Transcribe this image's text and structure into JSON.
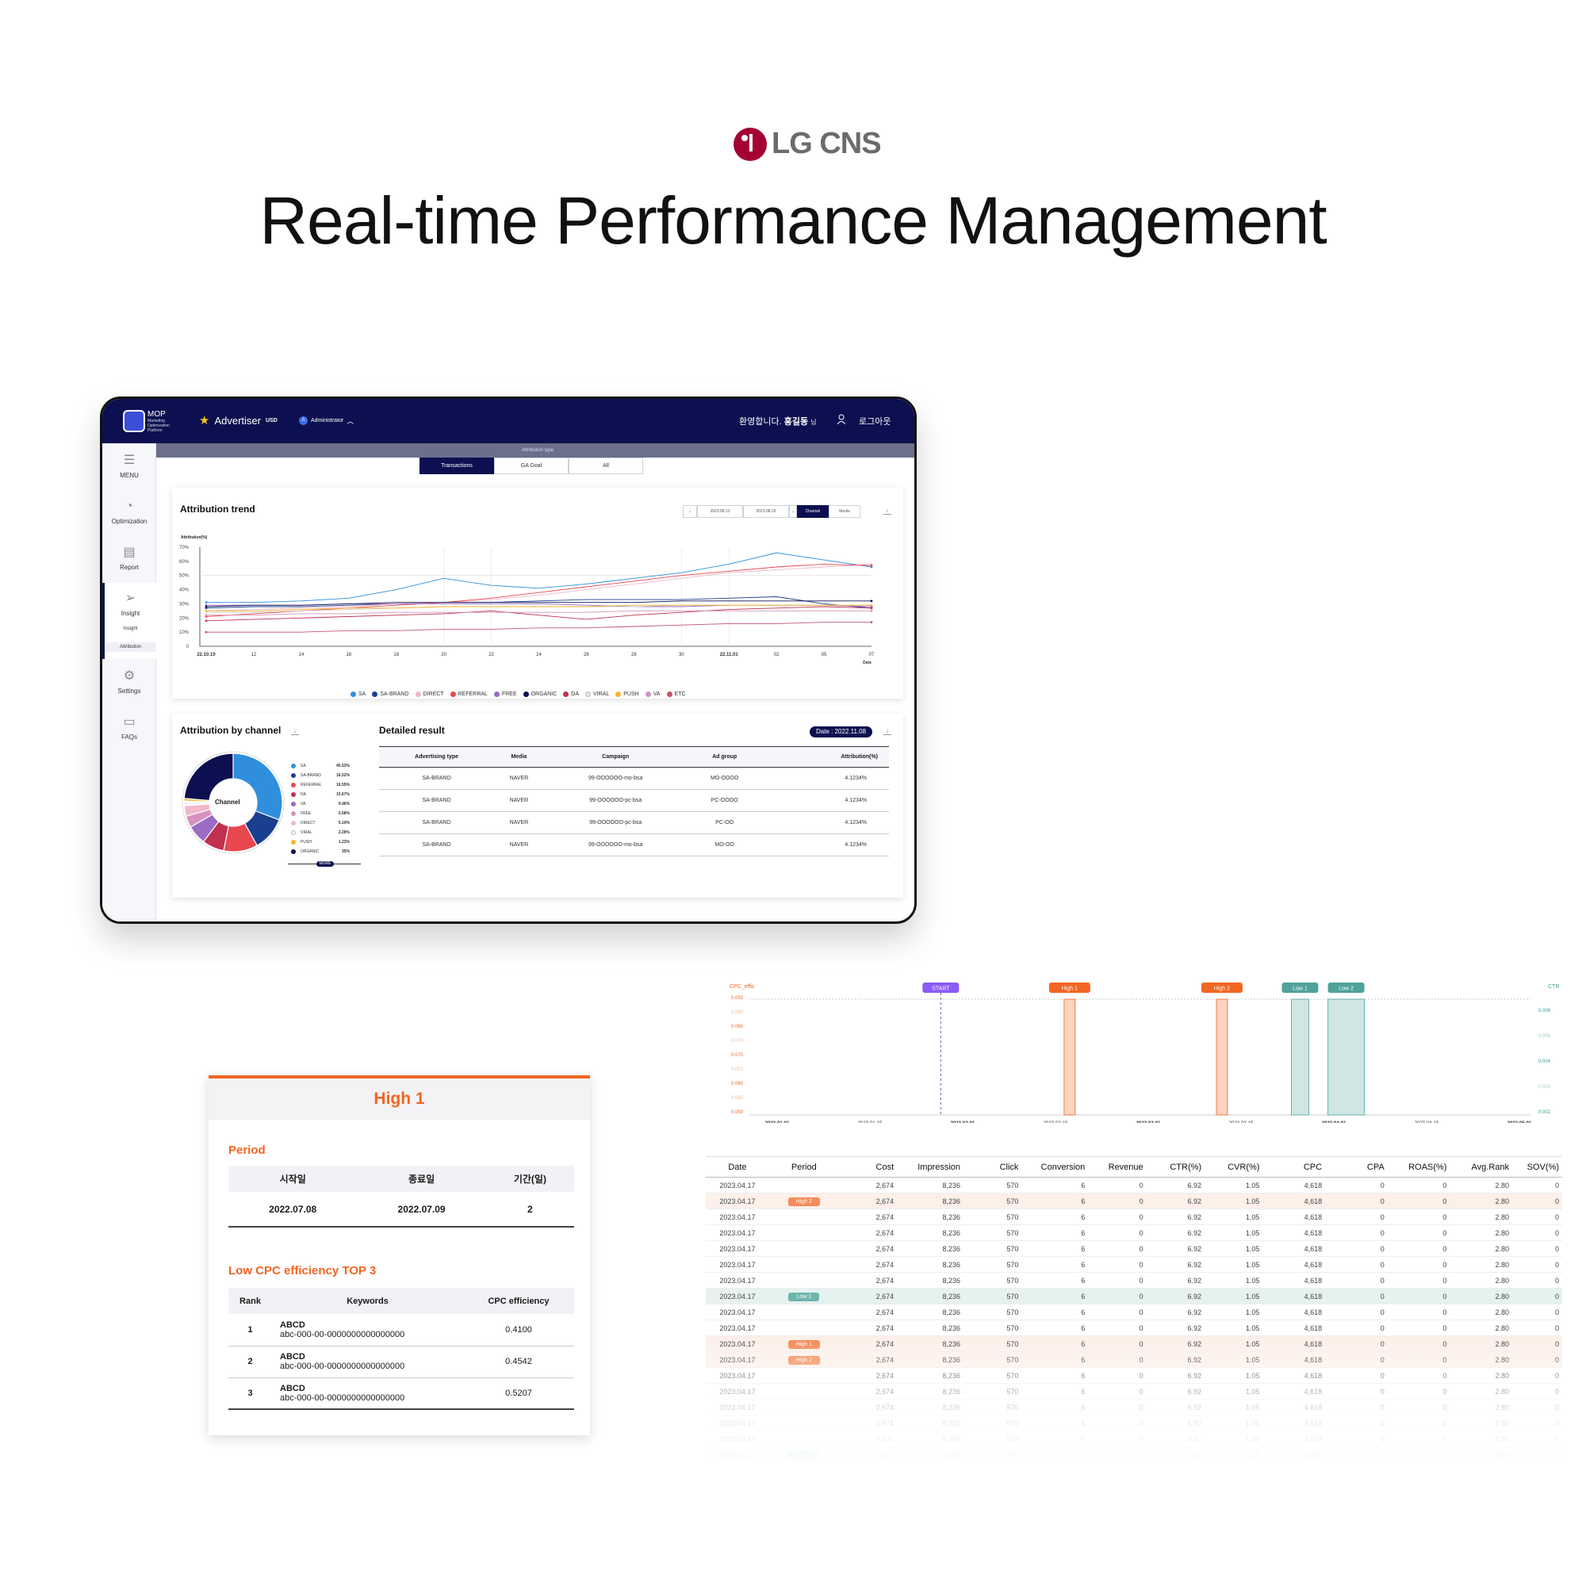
{
  "header": {
    "brand": "LG CNS",
    "title": "Real-time Performance Management"
  },
  "dashboard": {
    "topbar": {
      "logo": "MOP",
      "logo_sub": "Marketing Optimization Platform",
      "advertiser": "Advertiser",
      "currency": "USD",
      "role": "Administrator",
      "welcome_prefix": "환영합니다.",
      "user_name": "홍길동",
      "user_suffix": "님",
      "logout": "로그아웃"
    },
    "sidebar": [
      {
        "label": "MENU",
        "icon": "hamburger-icon"
      },
      {
        "label": "Optimization",
        "icon": "pie-icon"
      },
      {
        "label": "Report",
        "icon": "report-icon"
      },
      {
        "label": "Insight",
        "icon": "send-icon"
      },
      {
        "label": "Settings",
        "icon": "gear-icon"
      },
      {
        "label": "FAQs",
        "icon": "chat-icon"
      }
    ],
    "sidebar_sub": [
      "Insight",
      "Attribution"
    ],
    "attribution_type_label": "Attribution type",
    "tabs": [
      "Transactions",
      "GA Goal",
      "All"
    ],
    "trend": {
      "title": "Attribution trend",
      "date_from": "2023.08.12",
      "date_to": "2023.08.29",
      "toggle": [
        "Channel",
        "Media"
      ]
    },
    "by_channel": {
      "title": "Attribution by channel",
      "center": "Channel",
      "more": "MORE"
    },
    "detail": {
      "title": "Detailed result",
      "date_label": "Date : 2022.11.08",
      "headers": [
        "Advertising type",
        "Media",
        "Campaign",
        "Ad group",
        "Attribution(%)"
      ],
      "rows": [
        [
          "SA-BRAND",
          "NAVER",
          "99-OOOOOO-mo-bsa",
          "MO-OOOO",
          "4.1234%"
        ],
        [
          "SA-BRAND",
          "NAVER",
          "99-OOOOOO-pc-bsa",
          "PC-OOOO",
          "4.1234%"
        ],
        [
          "SA-BRAND",
          "NAVER",
          "99-OOOOOO-pc-bsa",
          "PC-OO",
          "4.1234%"
        ],
        [
          "SA-BRAND",
          "NAVER",
          "99-OOOOOO-mo-bsa",
          "MO-OO",
          "4.1234%"
        ]
      ]
    }
  },
  "chart_data": [
    {
      "type": "line",
      "title": "Attribution trend",
      "ylabel": "Attribution(%)",
      "xlabel": "Date",
      "ylim": [
        0,
        70
      ],
      "yticks": [
        "0",
        "10%",
        "20%",
        "30%",
        "40%",
        "50%",
        "60%",
        "70%"
      ],
      "x": [
        "22.10.10",
        "12",
        "14",
        "16",
        "18",
        "20",
        "22",
        "24",
        "26",
        "28",
        "30",
        "22.11.01",
        "02",
        "05",
        "07"
      ],
      "series": [
        {
          "name": "SA",
          "color": "#2f8fdc",
          "values": [
            31,
            31,
            32,
            34,
            40,
            48,
            43,
            41,
            44,
            48,
            52,
            58,
            66,
            61,
            56
          ]
        },
        {
          "name": "SA-BRAND",
          "color": "#1a3f8f",
          "values": [
            27,
            28,
            28,
            29,
            30,
            31,
            31,
            32,
            33,
            33,
            33,
            34,
            35,
            30,
            27
          ]
        },
        {
          "name": "DIRECT",
          "color": "#f0b8c8",
          "values": [
            25,
            26,
            27,
            28,
            30,
            31,
            33,
            36,
            40,
            44,
            48,
            52,
            54,
            56,
            58
          ]
        },
        {
          "name": "REFERRAL",
          "color": "#e8474e",
          "values": [
            21,
            23,
            25,
            27,
            29,
            31,
            34,
            38,
            42,
            46,
            50,
            53,
            56,
            58,
            57
          ]
        },
        {
          "name": "FREE",
          "color": "#9b6cc4",
          "values": [
            29,
            29,
            29,
            30,
            30,
            30,
            30,
            30,
            29,
            28,
            28,
            29,
            29,
            29,
            28
          ]
        },
        {
          "name": "ORGANIC",
          "color": "#0c1050",
          "values": [
            28,
            29,
            29,
            30,
            31,
            31,
            31,
            31,
            31,
            31,
            32,
            32,
            32,
            32,
            32
          ]
        },
        {
          "name": "DA",
          "color": "#c0304f",
          "values": [
            18,
            19,
            20,
            21,
            22,
            23,
            25,
            22,
            19,
            22,
            24,
            26,
            27,
            28,
            27
          ]
        },
        {
          "name": "VIRAL",
          "color": "#e6e6e6",
          "values": [
            24,
            24,
            25,
            26,
            27,
            28,
            28,
            28,
            28,
            28,
            29,
            29,
            29,
            29,
            29
          ]
        },
        {
          "name": "PUSH",
          "color": "#f4b32b",
          "values": [
            25,
            25,
            26,
            27,
            27,
            28,
            28,
            28,
            28,
            29,
            29,
            29,
            29,
            29,
            29
          ]
        },
        {
          "name": "VA",
          "color": "#d592be",
          "values": [
            22,
            22,
            23,
            23,
            24,
            24,
            24,
            24,
            24,
            25,
            25,
            25,
            25,
            25,
            25
          ]
        },
        {
          "name": "ETC",
          "color": "#c4566b",
          "values": [
            10,
            10,
            10,
            11,
            11,
            12,
            12,
            13,
            13,
            14,
            15,
            16,
            16,
            17,
            17
          ]
        }
      ]
    },
    {
      "type": "pie",
      "title": "Attribution by channel",
      "categories": [
        "SA",
        "SA-BRAND",
        "REFERRAL",
        "DA",
        "VA",
        "FREE",
        "DIRECT",
        "VIRAL",
        "PUSH",
        "ORGANIC"
      ],
      "values": [
        45.53,
        16.52,
        16.55,
        10.67,
        9.46,
        5.58,
        5.19,
        2.28,
        1.23,
        35
      ],
      "labels": [
        "45.53%",
        "16.52%",
        "16.55%",
        "10.67%",
        "9.46%",
        "5.58%",
        "5.19%",
        "2.28%",
        "1.23%",
        "35%"
      ],
      "colors": [
        "#2f8fdc",
        "#1a3f8f",
        "#e8474e",
        "#c0304f",
        "#9b6cc4",
        "#d592be",
        "#f0b8c8",
        "#f4f4f4",
        "#f4b32b",
        "#0c1050"
      ]
    },
    {
      "type": "line",
      "left_label": "CPC_effic",
      "right_label": "CTR",
      "left_ticks": [
        "0.050",
        "0.060",
        "0.060",
        "0.070",
        "0.070",
        "0.051",
        "0.060",
        "0.060",
        "0.050",
        "0.050"
      ],
      "right_ticks": [
        "0.006",
        "0.005",
        "0.004",
        "0.003",
        "0.002"
      ],
      "x": [
        "2023-01-01",
        "2023-01-15",
        "2023-02-01",
        "2023-02-15",
        "2023-03-01",
        "2023-03-15",
        "2023-04-01",
        "2023-04-15",
        "2023-05-01"
      ],
      "markers": [
        {
          "label": "START",
          "x": 0.245,
          "kind": "start"
        },
        {
          "label": "High 1",
          "x": 0.41,
          "kind": "high"
        },
        {
          "label": "High 2",
          "x": 0.605,
          "kind": "high"
        },
        {
          "label": "Low 1",
          "x": 0.705,
          "kind": "low"
        },
        {
          "label": "Low 2",
          "x": 0.764,
          "kind": "low"
        }
      ]
    }
  ],
  "high_card": {
    "title": "High 1",
    "period_label": "Period",
    "period_headers": [
      "시작일",
      "종료일",
      "기간(일)"
    ],
    "period_values": [
      "2022.07.08",
      "2022.07.09",
      "2"
    ],
    "top_label": "Low CPC efficiency TOP 3",
    "rank_headers": [
      "Rank",
      "Keywords",
      "CPC efficiency"
    ],
    "ranks": [
      {
        "rank": "1",
        "kw": "ABCD",
        "kw2": "abc-000-00-0000000000000000",
        "eff": "0.4100"
      },
      {
        "rank": "2",
        "kw": "ABCD",
        "kw2": "abc-000-00-0000000000000000",
        "eff": "0.4542"
      },
      {
        "rank": "3",
        "kw": "ABCD",
        "kw2": "abc-000-00-0000000000000000",
        "eff": "0.5207"
      }
    ]
  },
  "perf_table": {
    "headers": [
      "Date",
      "Period",
      "Cost",
      "Impression",
      "Click",
      "Conversion",
      "Revenue",
      "CTR(%)",
      "CVR(%)",
      "CPC",
      "CPA",
      "ROAS(%)",
      "Avg.Rank",
      "SOV(%)"
    ],
    "base_row": [
      "2023.04.17",
      "",
      "2,674",
      "8,236",
      "570",
      "6",
      "0",
      "6.92",
      "1.05",
      "4,618",
      "0",
      "0",
      "2.80",
      "0"
    ],
    "periods": [
      "",
      "High 2",
      "",
      "",
      "",
      "",
      "",
      "Low 1",
      "",
      "",
      "High 1",
      "High 2",
      "",
      "",
      "",
      "",
      "",
      "Low 1"
    ]
  }
}
